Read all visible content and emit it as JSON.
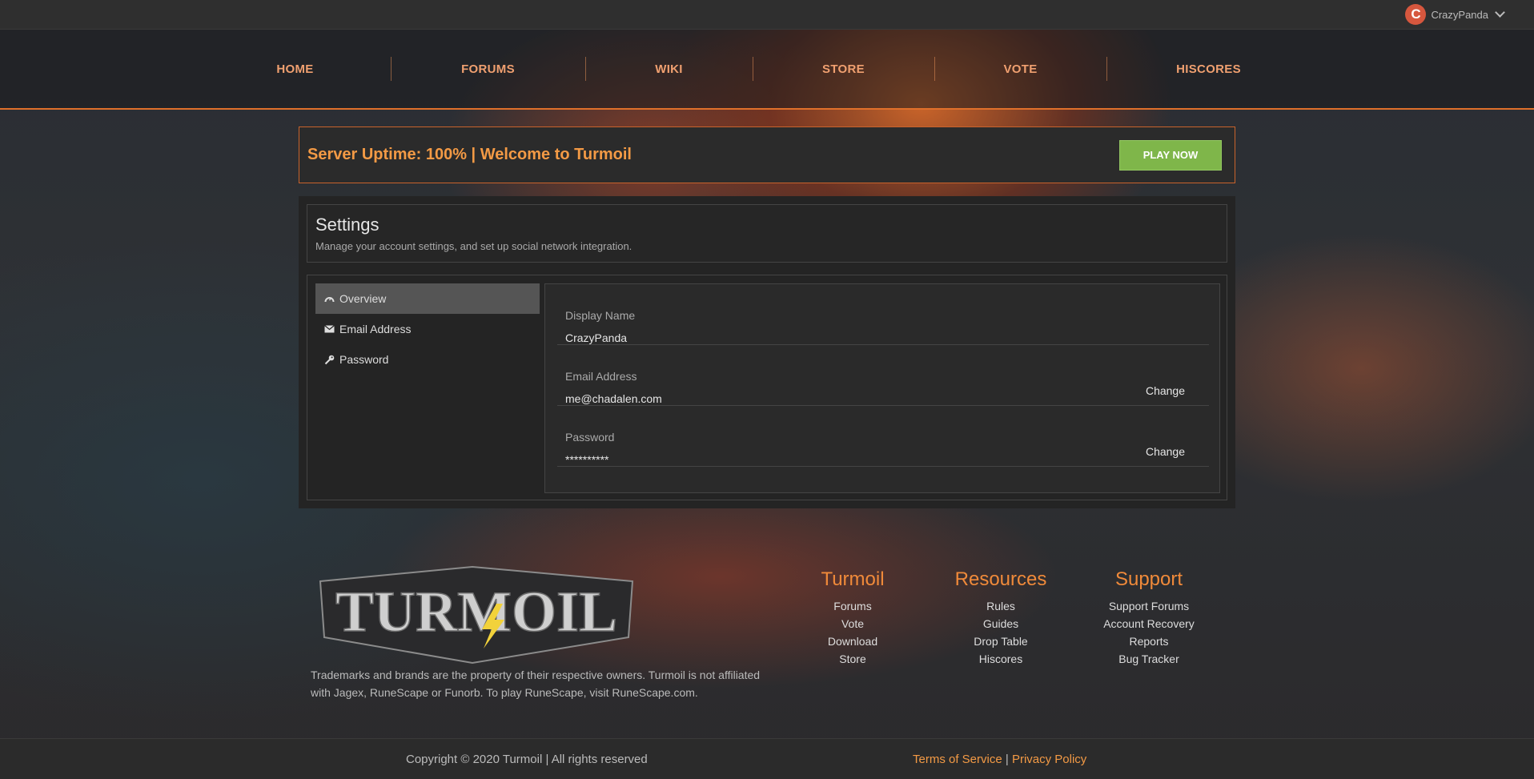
{
  "user": {
    "avatar_letter": "C",
    "name": "CrazyPanda"
  },
  "nav": [
    "HOME",
    "FORUMS",
    "WIKI",
    "STORE",
    "VOTE",
    "HISCORES"
  ],
  "banner": {
    "text": "Server Uptime: 100% | Welcome to Turmoil",
    "play_label": "PLAY NOW"
  },
  "settings": {
    "title": "Settings",
    "subtitle": "Manage your account settings, and set up social network integration.",
    "menu": [
      {
        "label": "Overview",
        "icon": "dashboard-icon"
      },
      {
        "label": "Email Address",
        "icon": "envelope-icon"
      },
      {
        "label": "Password",
        "icon": "key-icon"
      }
    ],
    "fields": [
      {
        "label": "Display Name",
        "value": "CrazyPanda",
        "action": ""
      },
      {
        "label": "Email Address",
        "value": "me@chadalen.com",
        "action": "Change"
      },
      {
        "label": "Password",
        "value": "**********",
        "action": "Change"
      }
    ]
  },
  "footer": {
    "logo_text": "TURMOIL",
    "disclaimer": "Trademarks and brands are the property of their respective owners. Turmoil is not affiliated with Jagex, RuneScape or Funorb. To play RuneScape, visit RuneScape.com.",
    "columns": [
      {
        "title": "Turmoil",
        "links": [
          "Forums",
          "Vote",
          "Download",
          "Store"
        ]
      },
      {
        "title": "Resources",
        "links": [
          "Rules",
          "Guides",
          "Drop Table",
          "Hiscores"
        ]
      },
      {
        "title": "Support",
        "links": [
          "Support Forums",
          "Account Recovery",
          "Reports",
          "Bug Tracker"
        ]
      }
    ],
    "copyright": "Copyright © 2020 Turmoil | All rights reserved",
    "terms": "Terms of Service",
    "separator": "|",
    "privacy": "Privacy Policy"
  },
  "colors": {
    "accent": "#f39a45",
    "play_button": "#7fb64a",
    "avatar": "#d6573e"
  }
}
